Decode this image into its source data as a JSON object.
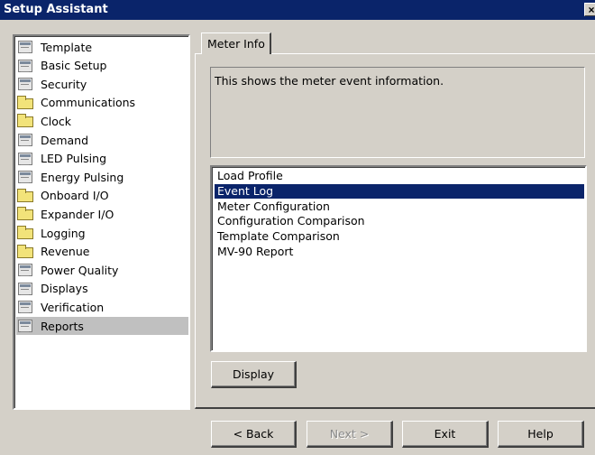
{
  "window": {
    "title": "Setup Assistant",
    "close_label": "×"
  },
  "sidebar": {
    "selected": "Reports",
    "items": [
      {
        "label": "Template",
        "icon": "document-icon"
      },
      {
        "label": "Basic Setup",
        "icon": "document-icon"
      },
      {
        "label": "Security",
        "icon": "document-icon"
      },
      {
        "label": "Communications",
        "icon": "folder-icon"
      },
      {
        "label": "Clock",
        "icon": "folder-icon"
      },
      {
        "label": "Demand",
        "icon": "document-icon"
      },
      {
        "label": "LED Pulsing",
        "icon": "document-icon"
      },
      {
        "label": "Energy Pulsing",
        "icon": "document-icon"
      },
      {
        "label": "Onboard I/O",
        "icon": "folder-icon"
      },
      {
        "label": "Expander I/O",
        "icon": "folder-icon"
      },
      {
        "label": "Logging",
        "icon": "folder-icon"
      },
      {
        "label": "Revenue",
        "icon": "folder-icon"
      },
      {
        "label": "Power Quality",
        "icon": "document-icon"
      },
      {
        "label": "Displays",
        "icon": "document-icon"
      },
      {
        "label": "Verification",
        "icon": "document-icon"
      },
      {
        "label": "Reports",
        "icon": "document-icon"
      }
    ]
  },
  "main": {
    "tab_label": "Meter Info",
    "description": "This shows the meter event information.",
    "reports": {
      "selected": "Event Log",
      "items": [
        "Load Profile",
        "Event Log",
        "Meter Configuration",
        "Configuration Comparison",
        "Template Comparison",
        "MV-90 Report"
      ]
    },
    "display_button": "Display"
  },
  "footer": {
    "back": "< Back",
    "next": "Next >",
    "exit": "Exit",
    "help": "Help"
  }
}
